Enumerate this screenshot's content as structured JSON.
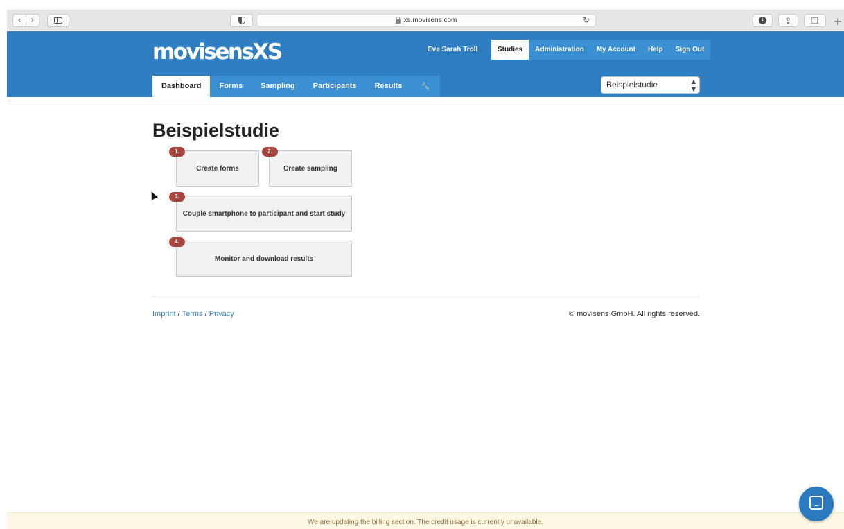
{
  "browser": {
    "back_glyph": "‹",
    "forward_glyph": "›",
    "url": "xs.movisens.com",
    "reload_glyph": "↻",
    "download_glyph": "↓",
    "share_glyph": "⇪",
    "tabs_glyph": "❐",
    "new_tab_glyph": "+"
  },
  "header": {
    "logo": "movisensXS",
    "username": "Eve Sarah Troll",
    "top_nav": [
      "Studies",
      "Administration",
      "My Account",
      "Help",
      "Sign Out"
    ],
    "active_top_nav": "Studies",
    "main_nav": [
      "Dashboard",
      "Forms",
      "Sampling",
      "Participants",
      "Results"
    ],
    "active_main_nav": "Dashboard",
    "settings_glyph": "🔧",
    "study_select": {
      "value": "Beispielstudie",
      "arrows": "▲▼"
    }
  },
  "main": {
    "title": "Beispielstudie",
    "steps": [
      {
        "badge": "1.",
        "label": "Create forms"
      },
      {
        "badge": "2.",
        "label": "Create sampling"
      },
      {
        "badge": "3.",
        "label": "Couple smartphone to participant and start study"
      },
      {
        "badge": "4.",
        "label": "Monitor and download results"
      }
    ]
  },
  "footer": {
    "imprint": "Imprint",
    "terms": "Terms",
    "privacy": "Privacy",
    "separator": " / ",
    "copyright": "© movisens GmbH. All rights reserved."
  },
  "notice": "We are updating the billing section. The credit usage is currently unavailable.",
  "colors": {
    "header_bg": "#2f7ec1",
    "nav_item_bg": "#3b8fd3",
    "badge_bg": "#a8453f",
    "notice_bg": "#fcf8e3",
    "notice_text": "#8a6d3b"
  }
}
